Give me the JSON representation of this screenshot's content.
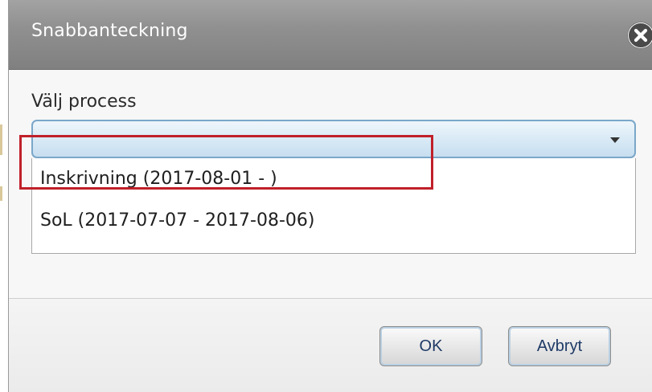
{
  "dialog": {
    "title": "Snabbanteckning",
    "close_icon": "close-circle-icon"
  },
  "form": {
    "process_label": "Välj process",
    "process_select_value": "",
    "process_options": [
      "Inskrivning (2017-08-01 - )",
      "SoL (2017-07-07 - 2017-08-06)"
    ]
  },
  "buttons": {
    "ok_label": "OK",
    "cancel_label": "Avbryt"
  },
  "colors": {
    "titlebar": "#8f8f8f",
    "select_border": "#7aa7c9",
    "highlight": "#c0202a",
    "button_text": "#1e3a66"
  }
}
